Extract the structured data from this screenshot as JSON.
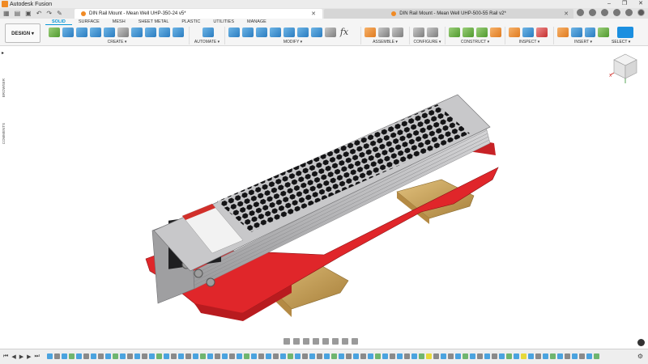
{
  "app": {
    "title": "Autodesk Fusion"
  },
  "window_controls": {
    "minimize": "–",
    "maximize": "❐",
    "close": "✕"
  },
  "tabs": [
    {
      "label": "DIN Rail Mount - Mean Well UHP-350-24 v5*",
      "close": "✕"
    },
    {
      "label": "DIN Rail Mount - Mean Well UHP-500-55 Rail v2*",
      "close": "✕"
    }
  ],
  "workspace": {
    "label": "DESIGN ▾"
  },
  "ribbon_tabs": [
    "SOLID",
    "SURFACE",
    "MESH",
    "SHEET METAL",
    "PLASTIC",
    "UTILITIES",
    "MANAGE"
  ],
  "tool_groups": [
    {
      "label": "CREATE ▾",
      "icons": [
        "sketch-icon",
        "box-icon",
        "revolve-icon",
        "sweep-icon",
        "loft-icon",
        "rib-icon",
        "hole-icon",
        "pattern-icon",
        "mirror-icon",
        "thicken-icon"
      ]
    },
    {
      "label": "AUTOMATE ▾",
      "icons": [
        "automate-icon"
      ]
    },
    {
      "label": "MODIFY ▾",
      "icons": [
        "press-pull-icon",
        "fillet-icon",
        "chamfer-icon",
        "shell-icon",
        "draft-icon",
        "scale-icon",
        "combine-icon",
        "move-icon",
        "fx-icon"
      ]
    },
    {
      "label": "ASSEMBLE ▾",
      "icons": [
        "new-component-icon",
        "joint-icon",
        "as-built-joint-icon"
      ]
    },
    {
      "label": "CONFIGURE ▾",
      "icons": [
        "configure-icon",
        "table-icon"
      ]
    },
    {
      "label": "CONSTRUCT ▾",
      "icons": [
        "offset-plane-icon",
        "plane-at-angle-icon",
        "axis-icon",
        "point-icon"
      ]
    },
    {
      "label": "INSPECT ▾",
      "icons": [
        "measure-icon",
        "section-icon",
        "interference-icon"
      ]
    },
    {
      "label": "INSERT ▾",
      "icons": [
        "insert-derive-icon",
        "insert-image-icon",
        "insert-mesh-icon",
        "insert-mcmaster-icon"
      ]
    }
  ],
  "select": {
    "label": "SELECT ▾"
  },
  "left_rail": {
    "browser": "BROWSER",
    "comments": "COMMENTS"
  },
  "viewcube": {
    "x_label": "X",
    "y_label": "Y",
    "z_label": "Z"
  },
  "timeline": {
    "first": "⏮",
    "prev": "◀",
    "play": "▶",
    "next": "▶",
    "last": "⏭",
    "settings": "⚙"
  },
  "colors": {
    "accent": "#0696d7",
    "psu_shell": "#b7b7b9",
    "psu_dark": "#3a3a3c",
    "mount_red": "#e0262a",
    "din_rail": "#c9a25a",
    "label_red": "#d12f2a"
  }
}
